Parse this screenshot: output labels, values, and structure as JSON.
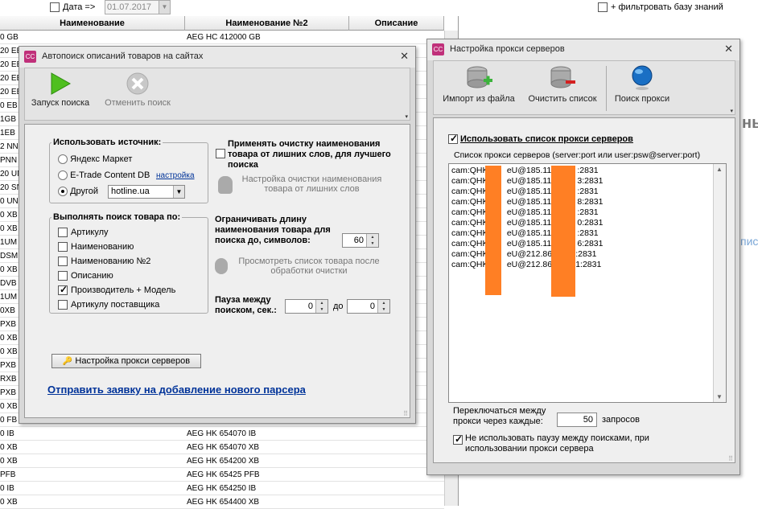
{
  "top_bar": {
    "date_label": "Дата =>",
    "date_value": "01.07.2017",
    "kb_filter_label": "+ фильтровать базу знаний"
  },
  "grid": {
    "columns": [
      "Наименование",
      "Наименование №2",
      "Описание"
    ],
    "rows": [
      [
        "0 GB",
        "AEG HC 412000 GB"
      ],
      [
        "20 EB",
        ""
      ],
      [
        "20 EB",
        ""
      ],
      [
        "20 EB",
        ""
      ],
      [
        "20 EB",
        ""
      ],
      [
        "0 EB",
        ""
      ],
      [
        "1GB",
        ""
      ],
      [
        "1EB",
        ""
      ],
      [
        "2 NN",
        ""
      ],
      [
        "PNN",
        ""
      ],
      [
        "20 UN",
        ""
      ],
      [
        "20 SN",
        ""
      ],
      [
        "0 UN",
        ""
      ],
      [
        "0 XB",
        ""
      ],
      [
        "0 XB",
        ""
      ],
      [
        "1UM",
        ""
      ],
      [
        "DSM",
        ""
      ],
      [
        "0 XB",
        ""
      ],
      [
        "DVB",
        ""
      ],
      [
        "1UM",
        ""
      ],
      [
        "0XB",
        ""
      ],
      [
        "PXB",
        ""
      ],
      [
        "0 XB",
        ""
      ],
      [
        "0 XB",
        ""
      ],
      [
        "PXB",
        ""
      ],
      [
        "RXB",
        ""
      ],
      [
        "PXB",
        ""
      ],
      [
        "0 XB",
        ""
      ],
      [
        "0 FB",
        ""
      ],
      [
        "0 IB",
        "AEG HK 654070 IB"
      ],
      [
        "0 XB",
        "AEG HK 654070 XB"
      ],
      [
        "0 XB",
        "AEG HK 654200 XB"
      ],
      [
        "PFB",
        "AEG HK 65425 PFB"
      ],
      [
        "0 IB",
        "AEG HK 654250 IB"
      ],
      [
        "0 XB",
        "AEG HK 654400 XB"
      ]
    ],
    "side_text_1": "ны",
    "side_text_2": "пис"
  },
  "autosearch": {
    "title": "Автопоиск описаний товаров на сайтах",
    "icon_text": "CC",
    "close": "✕",
    "start_label": "Запуск поиска",
    "cancel_label": "Отменить поиск",
    "source_group": "Использовать источник:",
    "sources": [
      "Яндекс Маркет",
      "E-Trade Content DB",
      "Другой"
    ],
    "settings_link": "настройка",
    "other_value": "hotline.ua",
    "search_by_group": "Выполнять поиск товара по:",
    "search_by": [
      {
        "label": "Артикулу",
        "checked": false
      },
      {
        "label": "Наименованию",
        "checked": false
      },
      {
        "label": "Наименованию №2",
        "checked": false
      },
      {
        "label": "Описанию",
        "checked": false
      },
      {
        "label": "Производитель + Модель",
        "checked": true
      },
      {
        "label": "Артикулу поставщика",
        "checked": false
      }
    ],
    "cleanup_label": "Применять очистку наименования товара от лишних слов, для лучшего поиска",
    "cleanup_settings": "Настройка очистки наименования товара от лишних слов",
    "limit_label": "Ограничивать длину наименования товара для поиска до, символов:",
    "limit_value": "60",
    "preview_label": "Просмотреть список товара после обработки очистки",
    "pause_label": "Пауза между поиском, сек.:",
    "pause_from": "0",
    "pause_to_label": "до",
    "pause_to": "0",
    "proxy_button": "Настройка прокси серверов",
    "request_link": "Отправить заявку на добавление нового парсера"
  },
  "proxy": {
    "title": "Настройка прокси серверов",
    "icon_text": "CC",
    "close": "✕",
    "import_label": "Импорт из файла",
    "clear_label": "Очистить список",
    "search_label": "Поиск прокси",
    "use_list_label": "Использовать список прокси серверов",
    "use_list_checked": true,
    "list_caption": "Список прокси серверов (server:port или user:psw@server:port)",
    "entries": [
      "cam:QHK        eU@185.112         :2831",
      "cam:QHK        eU@185.112         3:2831",
      "cam:QHK        eU@185.112         :2831",
      "cam:QHK        eU@185.112         8:2831",
      "cam:QHK        eU@185.112         :2831",
      "cam:QHK        eU@185.112         0:2831",
      "cam:QHK        eU@185.112         :2831",
      "cam:QHK        eU@185.112         6:2831",
      "cam:QHK        eU@212.86.         :2831",
      "cam:QHK        eU@212.86.         1:2831"
    ],
    "switch_label": "Переключаться между прокси через каждые:",
    "switch_value": "50",
    "switch_unit": "запросов",
    "no_pause_label": "Не использовать паузу между поисками, при использовании прокси сервера",
    "no_pause_checked": true
  },
  "colors": {
    "redaction": "#ff7f24",
    "link": "#003399",
    "start_icon": "#4fbf1f",
    "app_icon": "#c0307a"
  }
}
